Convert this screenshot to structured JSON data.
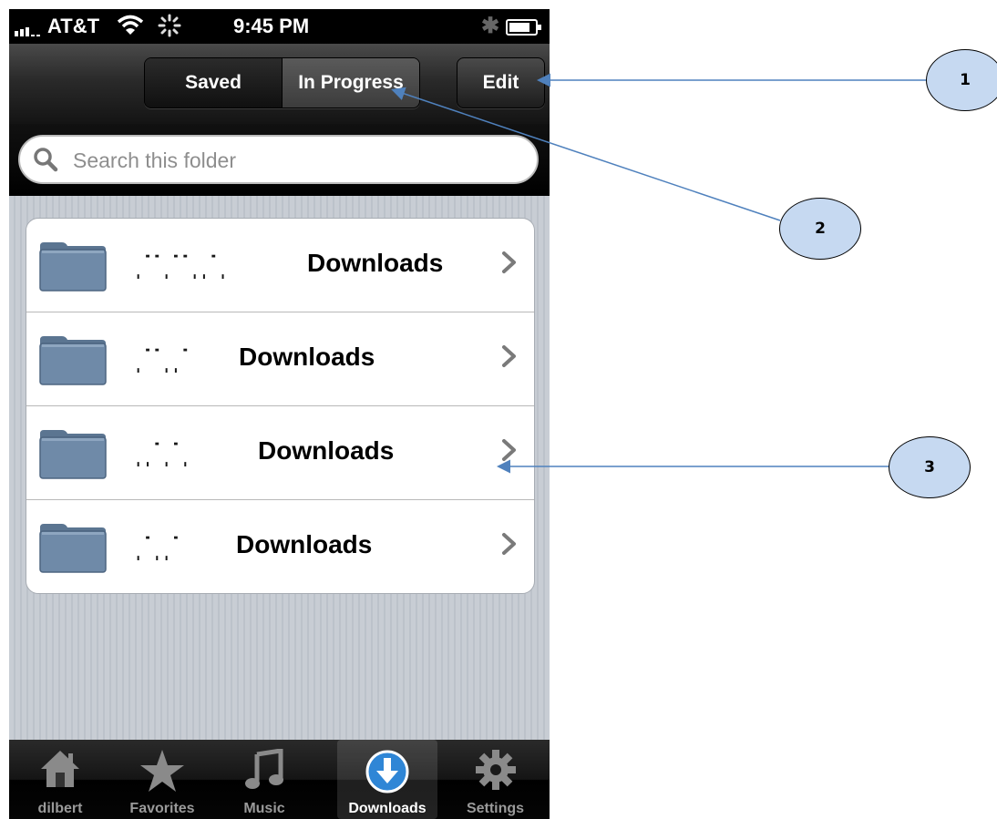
{
  "status_bar": {
    "carrier": "AT&T",
    "time": "9:45 PM"
  },
  "nav_bar": {
    "segments": [
      "Saved",
      "In Progress"
    ],
    "edit_label": "Edit"
  },
  "search": {
    "placeholder": "Search this folder"
  },
  "folders": [
    {
      "name_visible": "Downloads",
      "obscured_prefix": "ˌ˙˙˙˙˙˙ "
    },
    {
      "name_visible": "Downloads"
    },
    {
      "name_visible": "Downloads"
    },
    {
      "name_visible": "Downloads"
    }
  ],
  "tab_bar": {
    "tabs": [
      {
        "label": "dilbert",
        "icon": "home-icon"
      },
      {
        "label": "Favorites",
        "icon": "star-icon"
      },
      {
        "label": "Music",
        "icon": "music-note-icon"
      },
      {
        "label": "Downloads",
        "icon": "download-icon",
        "active": true
      },
      {
        "label": "Settings",
        "icon": "gear-icon"
      }
    ]
  },
  "callouts": [
    "1",
    "2",
    "3"
  ],
  "colors": {
    "callout_fill": "#c6d9f1",
    "arrow": "#4f81bd",
    "download_accent": "#2f86d6"
  }
}
